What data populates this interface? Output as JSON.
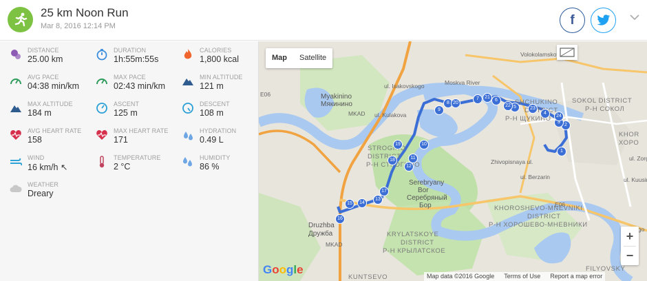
{
  "header": {
    "title": "25 km Noon Run",
    "subtitle": "Mar 8, 2016 12:14 PM",
    "facebook": "f",
    "colors": {
      "accent": "#7dc242",
      "facebook": "#3b5998",
      "twitter": "#1da1f2"
    }
  },
  "stats": [
    {
      "label": "DISTANCE",
      "value": "25.00 km",
      "icon": "distance-pin-icon",
      "color": "#8e5ab5"
    },
    {
      "label": "DURATION",
      "value": "1h:55m:55s",
      "icon": "stopwatch-icon",
      "color": "#3a8dde"
    },
    {
      "label": "CALORIES",
      "value": "1,800 kcal",
      "icon": "flame-icon",
      "color": "#f0652d"
    },
    {
      "label": "AVG PACE",
      "value": "04:38 min/km",
      "icon": "gauge-icon",
      "color": "#2e9b5a"
    },
    {
      "label": "MAX PACE",
      "value": "02:43 min/km",
      "icon": "gauge-icon",
      "color": "#2e9b5a"
    },
    {
      "label": "MIN ALTITUDE",
      "value": "121 m",
      "icon": "mountain-icon",
      "color": "#2f5c8f"
    },
    {
      "label": "MAX ALTITUDE",
      "value": "184 m",
      "icon": "mountain-icon",
      "color": "#2f5c8f"
    },
    {
      "label": "ASCENT",
      "value": "125 m",
      "icon": "ascent-gauge-icon",
      "color": "#2a9fd6"
    },
    {
      "label": "DESCENT",
      "value": "108 m",
      "icon": "descent-gauge-icon",
      "color": "#2a9fd6"
    },
    {
      "label": "AVG HEART RATE",
      "value": "158",
      "icon": "heart-rate-icon",
      "color": "#d6304d"
    },
    {
      "label": "MAX HEART RATE",
      "value": "171",
      "icon": "heart-rate-icon",
      "color": "#d6304d"
    },
    {
      "label": "HYDRATION",
      "value": "0.49 L",
      "icon": "water-drops-icon",
      "color": "#6fa6e4"
    },
    {
      "label": "WIND",
      "value": "16 km/h",
      "extra": "↖",
      "icon": "wind-icon",
      "color": "#2ea3d8"
    },
    {
      "label": "TEMPERATURE",
      "value": "2 °C",
      "icon": "thermometer-icon",
      "color": "#c0435f"
    },
    {
      "label": "HUMIDITY",
      "value": "86 %",
      "icon": "humidity-drops-icon",
      "color": "#6fa6e4"
    },
    {
      "label": "WEATHER",
      "value": "Dreary",
      "icon": "cloud-icon",
      "color": "#c8c8c8"
    }
  ],
  "map": {
    "toggle": {
      "map": "Map",
      "satellite": "Satellite"
    },
    "zoom_in": "+",
    "zoom_out": "−",
    "attribution": {
      "data": "Map data ©2016 Google",
      "terms": "Terms of Use",
      "report": "Report a map error"
    },
    "google": [
      "G",
      "o",
      "o",
      "g",
      "l",
      "e"
    ],
    "labels": [
      "Myakinino",
      "Мякинино",
      "STROGINO",
      "DISTRICT",
      "Р-Н СТРОГИНО",
      "Serebryany",
      "Bor",
      "Серебряный",
      "Бор",
      "KRYLATSKOYE",
      "DISTRICT",
      "Р-Н КРЫЛАТСКОЕ",
      "Druzhba",
      "Дружба",
      "KUNTSEVO",
      "SHCHUKINO",
      "DISTRICT",
      "Р-Н ЩУКИНО",
      "SOKOL DISTRICT",
      "Р-Н СОКОЛ",
      "KHOR",
      "ХОРО",
      "KHOROSHEVO-MNEVNIKI",
      "DISTRICT",
      "Р-Н ХОРОШЕВО-МНЕВНИКИ",
      "FILYOVSKY",
      "Volokolamskoye sh",
      "Moskva River",
      "ul. Isakovskogo",
      "ul. Kulakova",
      "MKAD",
      "MKAD",
      "Zhivopisnaya ul.",
      "ul. Berzarin",
      "ul. Kuusinena",
      "ul. Zorge",
      "Zvenigo",
      "E06",
      "E06"
    ],
    "route_markers": [
      "1",
      "2",
      "3",
      "4",
      "5",
      "6",
      "7",
      "8",
      "9",
      "10",
      "11",
      "12",
      "13",
      "14",
      "15",
      "16",
      "17",
      "18",
      "19",
      "20",
      "21",
      "22",
      "23",
      "24"
    ]
  }
}
